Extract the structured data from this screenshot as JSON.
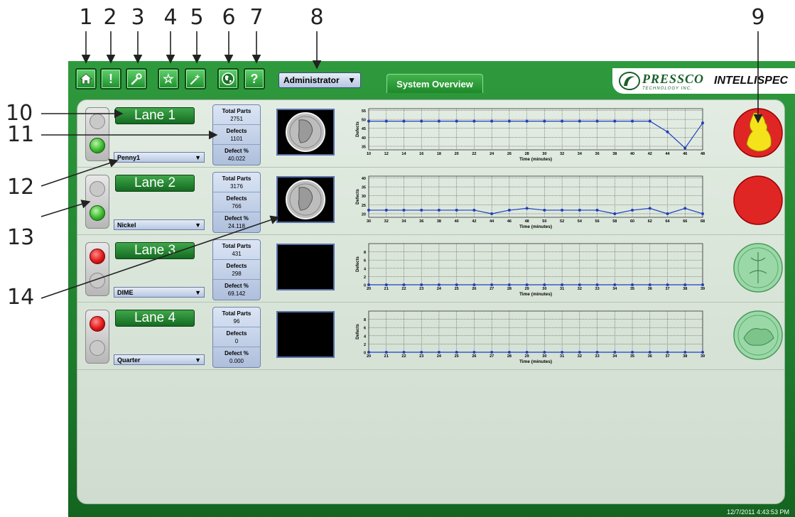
{
  "callouts": [
    "1",
    "2",
    "3",
    "4",
    "5",
    "6",
    "7",
    "8",
    "9",
    "10",
    "11",
    "12",
    "13",
    "14"
  ],
  "toolbar": {
    "buttons": [
      {
        "icon": "home-icon"
      },
      {
        "icon": "alert-icon",
        "glyph": "!"
      },
      {
        "icon": "wrench-icon"
      },
      {
        "icon": "star-icon",
        "glyph": "☆"
      },
      {
        "icon": "magic-wand-icon"
      },
      {
        "icon": "globe-icon"
      },
      {
        "icon": "help-icon",
        "glyph": "?"
      }
    ],
    "user_role": "Administrator",
    "active_tab": "System Overview"
  },
  "brand": {
    "company": "PRESSCO",
    "sub": "TECHNOLOGY INC.",
    "product": "INTELLISPEC"
  },
  "status": {
    "datetime": "12/7/2011 4:43:53 PM"
  },
  "colors": {
    "frame": "#1f7f2f",
    "panel": "#dfe9df",
    "series": "#1f3fbf",
    "coin_red": "#e02525",
    "coin_yellow": "#f4e21a",
    "coin_green": "#9bd8a8"
  },
  "lanes": [
    {
      "label": "Lane 1",
      "lights": [
        "gray",
        "green"
      ],
      "product": "Penny1",
      "stats": {
        "total_label": "Total Parts",
        "total": "2751",
        "defects_label": "Defects",
        "defects": "1101",
        "pct_label": "Defect %",
        "pct": "40.022"
      },
      "thumb": "penny-image",
      "coin": "red-yellow",
      "chart": {
        "y_label": "Defects",
        "x_label": "Time (minutes)",
        "y_min": 33,
        "y_max": 56,
        "y_ticks": [
          35,
          40,
          45,
          50,
          55
        ],
        "x": [
          10,
          12,
          14,
          16,
          18,
          20,
          22,
          24,
          26,
          28,
          30,
          32,
          34,
          36,
          38,
          40,
          42,
          44,
          46,
          48
        ],
        "values": [
          49,
          49,
          49,
          49,
          49,
          49,
          49,
          49,
          49,
          49,
          49,
          49,
          49,
          49,
          49,
          49,
          49,
          43,
          34,
          48
        ]
      }
    },
    {
      "label": "Lane 2",
      "lights": [
        "gray",
        "green"
      ],
      "product": "Nickel",
      "stats": {
        "total_label": "Total Parts",
        "total": "3176",
        "defects_label": "Defects",
        "defects": "766",
        "pct_label": "Defect %",
        "pct": "24.118"
      },
      "thumb": "nickel-image",
      "coin": "red",
      "chart": {
        "y_label": "Defects",
        "x_label": "Time (minutes)",
        "y_min": 18,
        "y_max": 41,
        "y_ticks": [
          20,
          25,
          30,
          35,
          40
        ],
        "x": [
          30,
          32,
          34,
          36,
          38,
          40,
          42,
          44,
          46,
          48,
          50,
          52,
          54,
          56,
          58,
          60,
          62,
          64,
          66,
          68
        ],
        "values": [
          22,
          22,
          22,
          22,
          22,
          22,
          22,
          20,
          22,
          23,
          22,
          22,
          22,
          22,
          20,
          22,
          23,
          20,
          23,
          20
        ]
      }
    },
    {
      "label": "Lane 3",
      "lights": [
        "red",
        "gray"
      ],
      "product": "DIME",
      "stats": {
        "total_label": "Total Parts",
        "total": "431",
        "defects_label": "Defects",
        "defects": "298",
        "pct_label": "Defect %",
        "pct": "69.142"
      },
      "thumb": "empty",
      "coin": "green-dime",
      "chart": {
        "y_label": "Defects",
        "x_label": "Time (minutes)",
        "y_min": 0,
        "y_max": 10,
        "y_ticks": [
          0,
          2,
          4,
          6,
          8
        ],
        "x": [
          20,
          21,
          22,
          23,
          24,
          25,
          26,
          27,
          28,
          29,
          30,
          31,
          32,
          33,
          34,
          35,
          36,
          37,
          38,
          39
        ],
        "values": [
          0,
          0,
          0,
          0,
          0,
          0,
          0,
          0,
          0,
          0,
          0,
          0,
          0,
          0,
          0,
          0,
          0,
          0,
          0,
          0
        ]
      }
    },
    {
      "label": "Lane 4",
      "lights": [
        "red",
        "gray"
      ],
      "product": "Quarter",
      "stats": {
        "total_label": "Total Parts",
        "total": "96",
        "defects_label": "Defects",
        "defects": "0",
        "pct_label": "Defect %",
        "pct": "0.000"
      },
      "thumb": "empty",
      "coin": "green-quarter",
      "chart": {
        "y_label": "Defects",
        "x_label": "Time (minutes)",
        "y_min": 0,
        "y_max": 10,
        "y_ticks": [
          0,
          2,
          4,
          6,
          8
        ],
        "x": [
          20,
          21,
          22,
          23,
          24,
          25,
          26,
          27,
          28,
          29,
          30,
          31,
          32,
          33,
          34,
          35,
          36,
          37,
          38,
          39
        ],
        "values": [
          0,
          0,
          0,
          0,
          0,
          0,
          0,
          0,
          0,
          0,
          0,
          0,
          0,
          0,
          0,
          0,
          0,
          0,
          0,
          0
        ]
      }
    }
  ]
}
